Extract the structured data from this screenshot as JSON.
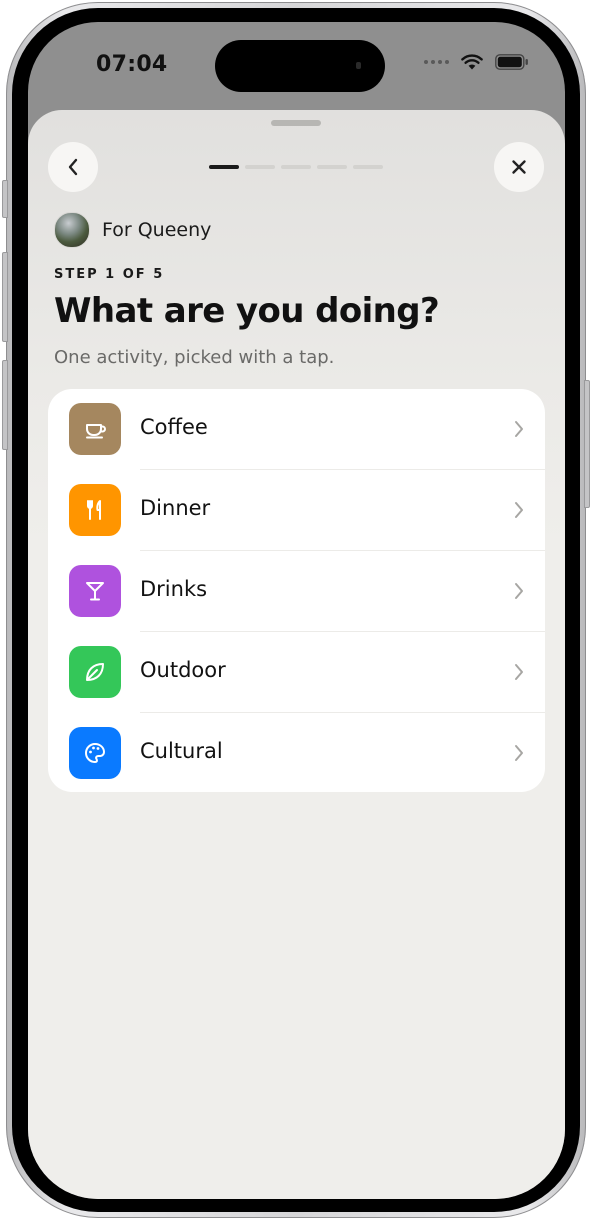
{
  "status_bar": {
    "time": "07:04"
  },
  "nav": {
    "back_icon": "chevron-left-icon",
    "close_icon": "close-icon",
    "progress": {
      "current_step": 1,
      "total_steps": 5
    }
  },
  "recipient": {
    "name": "For Queeny"
  },
  "header": {
    "step": "STEP 1 OF 5",
    "title": "What are you doing?",
    "subtitle": "One activity, picked with a tap."
  },
  "activities": [
    {
      "label": "Coffee",
      "icon": "coffee-cup-icon",
      "color": "#A5875F"
    },
    {
      "label": "Dinner",
      "icon": "fork-knife-icon",
      "color": "#FF9500"
    },
    {
      "label": "Drinks",
      "icon": "cocktail-glass-icon",
      "color": "#AF52DE"
    },
    {
      "label": "Outdoor",
      "icon": "leaf-icon",
      "color": "#34C759"
    },
    {
      "label": "Cultural",
      "icon": "palette-icon",
      "color": "#0A7AFF"
    }
  ]
}
